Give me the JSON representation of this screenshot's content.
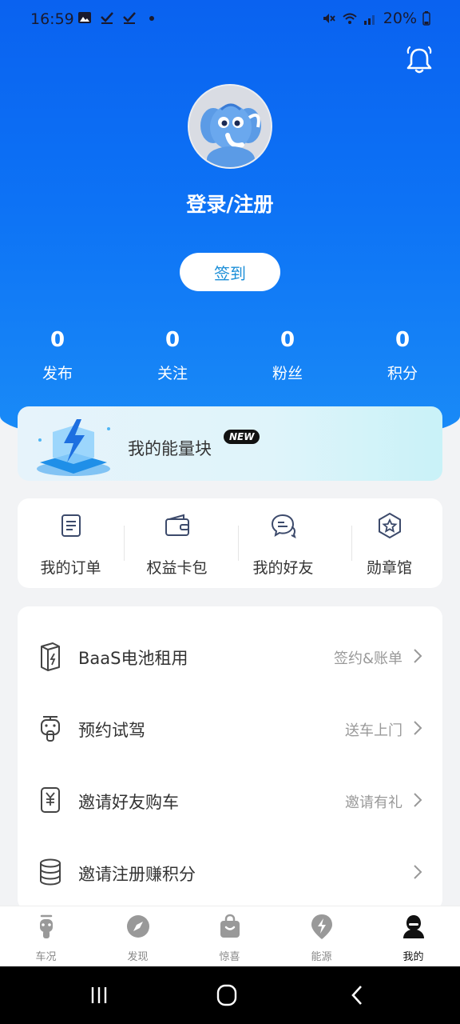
{
  "status_bar": {
    "time": "16:59",
    "battery": "20%",
    "icons": [
      "image-icon",
      "check-icon",
      "check-icon",
      "dot-icon",
      "mute-icon",
      "wifi-icon",
      "signal-icon",
      "battery-icon"
    ]
  },
  "profile": {
    "login_label": "登录/注册",
    "signin_button": "签到",
    "avatar": "elephant-mascot-avatar"
  },
  "stats": [
    {
      "value": "0",
      "label": "发布"
    },
    {
      "value": "0",
      "label": "关注"
    },
    {
      "value": "0",
      "label": "粉丝"
    },
    {
      "value": "0",
      "label": "积分"
    }
  ],
  "energy_card": {
    "title": "我的能量块",
    "badge": "NEW"
  },
  "quick_actions": [
    {
      "label": "我的订单",
      "icon": "order-list-icon"
    },
    {
      "label": "权益卡包",
      "icon": "wallet-icon"
    },
    {
      "label": "我的好友",
      "icon": "chat-friends-icon"
    },
    {
      "label": "勋章馆",
      "icon": "medal-star-icon"
    }
  ],
  "menu_rows": [
    {
      "label": "BaaS电池租用",
      "sub": "签约&账单",
      "icon": "battery-lightning-icon"
    },
    {
      "label": "预约试驾",
      "sub": "送车上门",
      "icon": "scooter-icon"
    },
    {
      "label": "邀请好友购车",
      "sub": "邀请有礼",
      "icon": "yuan-phone-icon"
    },
    {
      "label": "邀请注册赚积分",
      "sub": "",
      "icon": "coin-stack-icon"
    }
  ],
  "tabs": [
    {
      "label": "车况",
      "icon": "scooter-tab-icon"
    },
    {
      "label": "发现",
      "icon": "compass-icon"
    },
    {
      "label": "惊喜",
      "icon": "shopping-bag-icon"
    },
    {
      "label": "能源",
      "icon": "lightning-pin-icon"
    },
    {
      "label": "我的",
      "icon": "person-icon",
      "active": true
    }
  ],
  "colors": {
    "hero_top": "#0a62f0",
    "hero_bottom": "#1a8cf7",
    "signin_text": "#1c8fd8",
    "background": "#f2f3f5"
  }
}
